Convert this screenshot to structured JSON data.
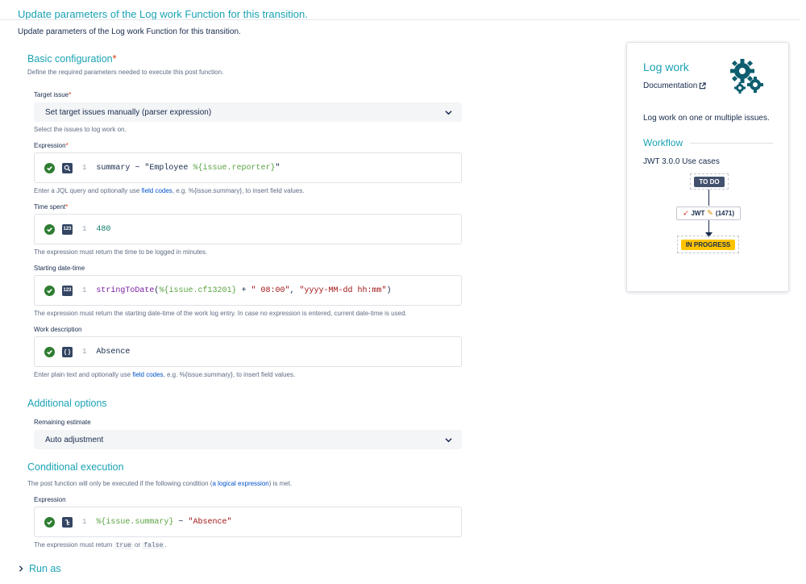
{
  "header": {
    "title": "Update parameters of the Log work Function for this transition.",
    "subtitle": "Update parameters of the Log work Function for this transition."
  },
  "basic": {
    "title": "Basic configuration",
    "required_mark": "*",
    "description": "Define the required parameters needed to execute this post function.",
    "target_issue": {
      "label": "Target issue",
      "value": "Set target issues manually (parser expression)",
      "help": "Select the issues to log work on."
    },
    "expression": {
      "label": "Expression",
      "line": "1",
      "code_plain": "summary ~ \"Employee ",
      "code_field": "%{issue.reporter}",
      "code_end": "\"",
      "help_before": "Enter a JQL query and optionally use ",
      "help_link": "field codes",
      "help_after": ", e.g. %{issue.summary}, to insert field values."
    },
    "time_spent": {
      "label": "Time spent",
      "line": "1",
      "code": "480",
      "help": "The expression must return the time to be logged in minutes."
    },
    "starting": {
      "label": "Starting date-time",
      "line": "1",
      "fn": "stringToDate",
      "open": "(",
      "field": "%{issue.cf13201}",
      "plus": " + ",
      "str1": "\" 08:00\"",
      "comma": ", ",
      "str2": "\"yyyy-MM-dd hh:mm\"",
      "close": ")",
      "help": "The expression must return the starting date-time of the work log entry. In case no expression is entered, current date-time is used."
    },
    "work_desc": {
      "label": "Work description",
      "line": "1",
      "code": "Absence",
      "help_before": "Enter plain text and optionally use ",
      "help_link": "field codes",
      "help_after": ", e.g. %{issue.summary}, to insert field values."
    }
  },
  "additional": {
    "title": "Additional options",
    "remaining_label": "Remaining estimate",
    "remaining_value": "Auto adjustment"
  },
  "conditional": {
    "title": "Conditional execution",
    "desc_before": "The post function will only be executed if the following condition (",
    "desc_link": "a logical expression",
    "desc_after": ") is met.",
    "expr_label": "Expression",
    "line": "1",
    "field": "%{issue.summary}",
    "op": " ~ ",
    "str": "\"Absence\"",
    "help_before": "The expression must return ",
    "help_true": "true",
    "help_or": " or ",
    "help_false": "false",
    "help_end": "."
  },
  "run_as": {
    "label": "Run as"
  },
  "sidebar": {
    "title": "Log work",
    "doc_link": "Documentation",
    "desc": "Log work on one or multiple issues.",
    "workflow_title": "Workflow",
    "use_case": "JWT 3.0.0 Use cases",
    "todo": "TO DO",
    "transition": "JWT",
    "transition_count": "(1471)",
    "in_progress": "IN PROGRESS"
  },
  "icons": {
    "check": "check-circle-icon",
    "jql": "search-icon",
    "number": "number-icon",
    "text": "text-icon",
    "logic": "logic-icon",
    "gears": "gears-icon",
    "chevron": "chevron-down-icon",
    "external": "external-link-icon"
  },
  "colors": {
    "accent": "#1ba3b4",
    "todo": "#42526e",
    "inprogress": "#ffc400",
    "ok": "#2e7d32"
  }
}
